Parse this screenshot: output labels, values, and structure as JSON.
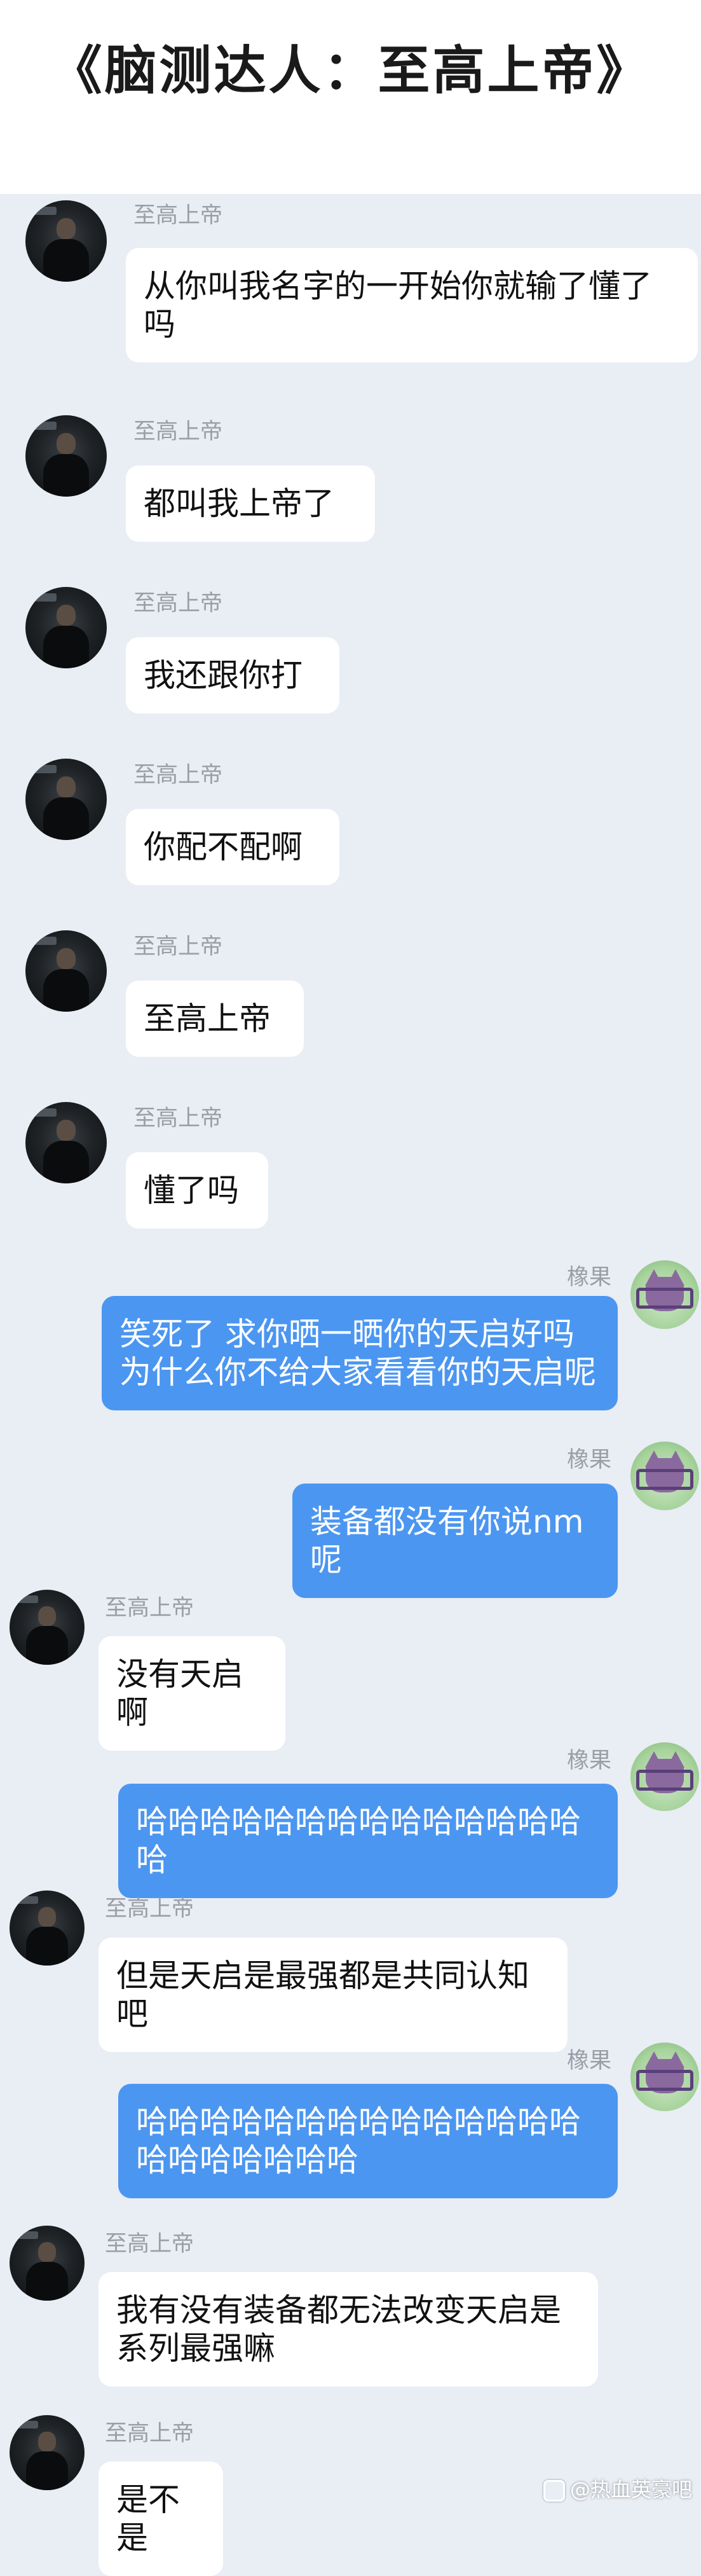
{
  "header": {
    "title": "《脑测达人：至高上帝》"
  },
  "messages": [
    {
      "side": "left",
      "sender": "至高上帝",
      "text": "从你叫我名字的一开始你就输了懂了吗"
    },
    {
      "side": "left",
      "sender": "至高上帝",
      "text": "都叫我上帝了"
    },
    {
      "side": "left",
      "sender": "至高上帝",
      "text": "我还跟你打"
    },
    {
      "side": "left",
      "sender": "至高上帝",
      "text": "你配不配啊"
    },
    {
      "side": "left",
      "sender": "至高上帝",
      "text": "至高上帝"
    },
    {
      "side": "left",
      "sender": "至高上帝",
      "text": "懂了吗"
    },
    {
      "side": "right",
      "sender": "橡果",
      "text": "笑死了 求你晒一晒你的天启好吗 为什么你不给大家看看你的天启呢"
    },
    {
      "side": "right",
      "sender": "橡果",
      "text": "装备都没有你说nm呢"
    },
    {
      "side": "left",
      "sender": "至高上帝",
      "text": "没有天启啊"
    },
    {
      "side": "right",
      "sender": "橡果",
      "text": "哈哈哈哈哈哈哈哈哈哈哈哈哈哈哈"
    },
    {
      "side": "left",
      "sender": "至高上帝",
      "text": "但是天启是最强都是共同认知吧"
    },
    {
      "side": "right",
      "sender": "橡果",
      "text": "哈哈哈哈哈哈哈哈哈哈哈哈哈哈哈哈哈哈哈哈哈"
    },
    {
      "side": "left",
      "sender": "至高上帝",
      "text": "我有没有装备都无法改变天启是系列最强嘛"
    },
    {
      "side": "left",
      "sender": "至高上帝",
      "text": "是不是"
    }
  ],
  "watermark": {
    "text": "@热血英豪吧"
  },
  "icons": {
    "left_avatar": "man-in-dark-coat-avatar",
    "right_avatar": "purple-cat-avatar"
  },
  "colors": {
    "background": "#e9edf4",
    "bubble_left": "#ffffff",
    "bubble_right": "#4b96f1",
    "name": "#9a9ea6"
  }
}
